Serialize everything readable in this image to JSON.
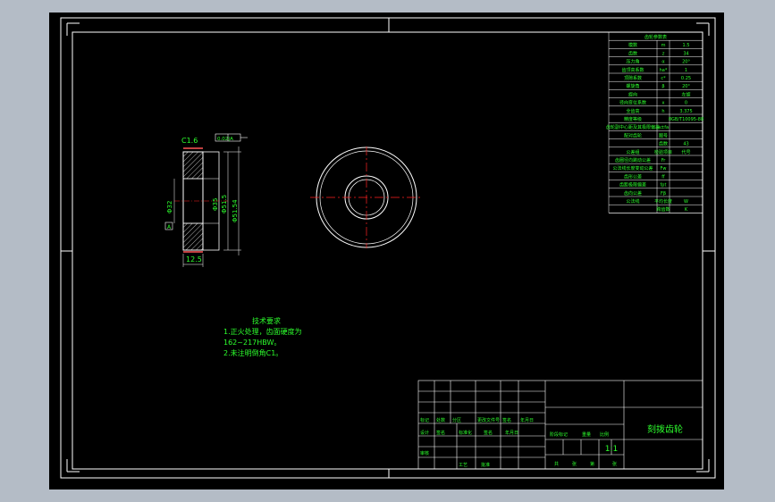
{
  "technical_requirements": {
    "title": "技术要求",
    "lines": [
      "1.正火处理，齿面硬度为",
      "162~217HBW。",
      "2.未注明倒角C1。"
    ]
  },
  "dimensions": {
    "chamfer": "C1.6",
    "width": "12.5",
    "bore": "Φ32",
    "pitch_diameter": "Φ51.5",
    "hub": "Φ35",
    "outer": "Φ51.54",
    "tolerance_box": "0.02|A",
    "datum": "A"
  },
  "title_block": {
    "drawing_name": "刻拨齿轮",
    "scale": "1:1",
    "labels_row1": [
      "标记",
      "处数",
      "分区",
      "更改文件号",
      "签名",
      "年月日"
    ],
    "labels_row2": [
      "设计",
      "签名",
      "标准化",
      "签名",
      "年月日"
    ],
    "labels_row3": [
      "审核",
      "工艺",
      "批准"
    ],
    "stage_labels": [
      "阶段标记",
      "重量",
      "比例"
    ],
    "bottom_labels": [
      "共",
      "张",
      "第",
      "张"
    ]
  },
  "gear_params": {
    "header": "齿轮参数表",
    "rows": [
      [
        "模数",
        "m",
        "1.5"
      ],
      [
        "齿数",
        "z",
        "34"
      ],
      [
        "压力角",
        "α",
        "20°"
      ],
      [
        "齿顶高系数",
        "ha*",
        "1"
      ],
      [
        "顶隙系数",
        "c*",
        "0.25"
      ],
      [
        "螺旋角",
        "β",
        "20°"
      ],
      [
        "旋向",
        "",
        "左旋"
      ],
      [
        "径向变位系数",
        "x",
        "0"
      ],
      [
        "全齿高",
        "h",
        "3.375"
      ],
      [
        "精度等级",
        "",
        "8GB/T10095-88"
      ],
      [
        "齿轮副中心距及其极限偏差",
        "a±fa",
        ""
      ],
      [
        "配对齿轮",
        "图号",
        ""
      ],
      [
        "",
        "齿数",
        "43"
      ],
      [
        "公差组",
        "检验项目",
        "代号"
      ],
      [
        "齿圈径向跳动公差",
        "Fr",
        ""
      ],
      [
        "公法线长度变动公差",
        "Fw",
        ""
      ],
      [
        "齿形公差",
        "ff",
        ""
      ],
      [
        "齿距极限偏差",
        "fpt",
        ""
      ],
      [
        "齿向公差",
        "Fβ",
        ""
      ],
      [
        "公法线",
        "平均长度",
        "W"
      ],
      [
        "",
        "跨齿数",
        "K"
      ]
    ]
  },
  "colors": {
    "frame": "#ffffff",
    "text": "#2dff2d",
    "centerline": "#ff2222",
    "background": "#000000",
    "outer_bg": "#b4bcc6"
  }
}
